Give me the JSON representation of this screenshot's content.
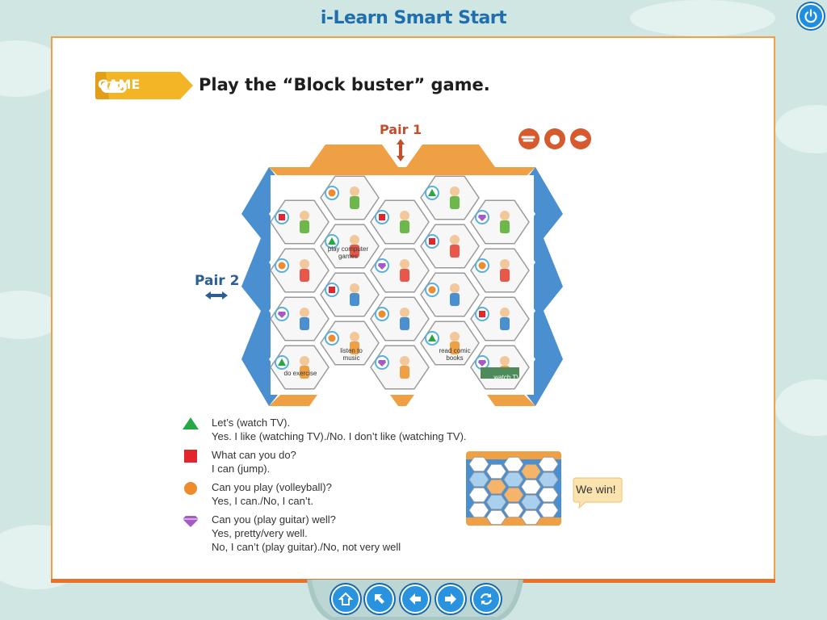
{
  "app": {
    "title": "i-Learn Smart Start"
  },
  "lesson": {
    "tag": "GAME",
    "instruction": "Play the “Block buster” game."
  },
  "board": {
    "pair1": "Pair 1",
    "pair2": "Pair 2",
    "cells": [
      {
        "label": ""
      },
      {
        "label": ""
      },
      {
        "label": ""
      },
      {
        "label": ""
      },
      {
        "label": ""
      },
      {
        "label": ""
      },
      {
        "label": ""
      },
      {
        "label": "play computer games"
      },
      {
        "label": ""
      },
      {
        "label": ""
      },
      {
        "label": ""
      },
      {
        "label": ""
      },
      {
        "label": ""
      },
      {
        "label": ""
      },
      {
        "label": ""
      },
      {
        "label": ""
      },
      {
        "label": ""
      },
      {
        "label": "listen to music"
      },
      {
        "label": ""
      },
      {
        "label": "read comic books"
      },
      {
        "label": "watch TV"
      },
      {
        "label": "do exercise"
      }
    ]
  },
  "legend": [
    {
      "symbol": "triangle",
      "color": "#27a745",
      "lines": [
        "Let’s (watch TV).",
        "Yes. I like (watching TV)./No. I don’t like (watching TV)."
      ]
    },
    {
      "symbol": "square",
      "color": "#e3262e",
      "lines": [
        "What can you do?",
        "I can (jump)."
      ]
    },
    {
      "symbol": "circle",
      "color": "#ef8b2c",
      "lines": [
        "Can you play (volleyball)?",
        "Yes, I can./No, I can’t."
      ]
    },
    {
      "symbol": "diamond",
      "color": "#a65bc4",
      "lines": [
        "Can you (play guitar) well?",
        "Yes, pretty/very well.",
        "No, I can’t (play guitar)./No, not very well"
      ]
    }
  ],
  "win_message": "We win!",
  "nav": [
    {
      "icon": "home-icon"
    },
    {
      "icon": "arrow-up-left-icon"
    },
    {
      "icon": "arrow-left-icon"
    },
    {
      "icon": "arrow-right-icon"
    },
    {
      "icon": "refresh-icon"
    }
  ],
  "colors": {
    "accent": "#1f6fb0",
    "board_orange": "#f0a044",
    "board_blue": "#4a8fd0",
    "page_border": "#f0a044"
  }
}
